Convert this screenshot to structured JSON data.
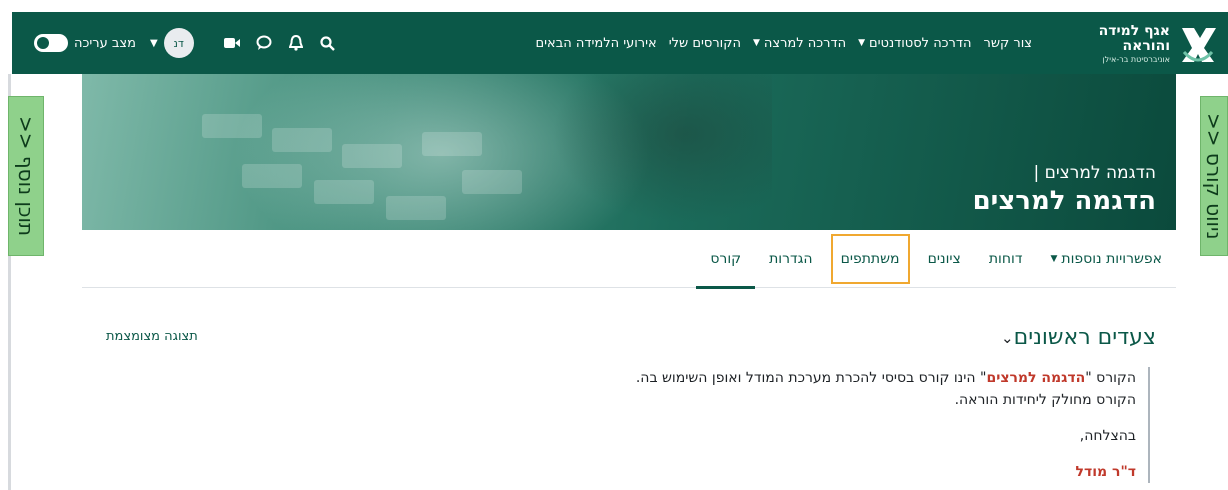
{
  "brand": {
    "line1": "אגף למידה",
    "line2": "והוראה",
    "line3": "אוניברסיטת בר-אילן"
  },
  "nav": {
    "items": [
      {
        "label": "אירועי הלמידה הבאים",
        "caret": false
      },
      {
        "label": "הקורסים שלי",
        "caret": false
      },
      {
        "label": "הדרכה למרצה",
        "caret": true
      },
      {
        "label": "הדרכה לסטודנטים",
        "caret": true
      },
      {
        "label": "צור קשר",
        "caret": false
      }
    ],
    "user_initials": "דנ",
    "edit_mode_label": "מצב עריכה",
    "icons": [
      "search-icon",
      "bell-icon",
      "chat-icon",
      "video-icon"
    ]
  },
  "drawers": {
    "left_label": "תוכן נוסף <<",
    "right_label": "ניווט קורס <<"
  },
  "banner": {
    "category": "הדגמה למרצים |",
    "title": "הדגמה למרצים"
  },
  "tabs": [
    {
      "label": "קורס",
      "active": true
    },
    {
      "label": "הגדרות"
    },
    {
      "label": "משתתפים",
      "highlight": true
    },
    {
      "label": "ציונים"
    },
    {
      "label": "דוחות"
    },
    {
      "label": "אפשרויות נוספות",
      "caret": true
    }
  ],
  "section": {
    "title": "צעדים ראשונים",
    "collapsed_view_label": "תצוגה מצומצמת",
    "para1_before": "הקורס \"",
    "para1_emph": "הדגמה למרצים",
    "para1_after": "\" הינו קורס בסיסי להכרת מערכת המודל ואופן השימוש בה.",
    "para2": "הקורס מחולק ליחידות הוראה.",
    "greeting": "בהצלחה,",
    "signature": "ד\"ר מודל"
  },
  "colors": {
    "navbar": "#0b5848",
    "drawer_tab": "#8fd18b",
    "highlight_outline": "#f0a830",
    "emphasis": "#c0392b"
  }
}
